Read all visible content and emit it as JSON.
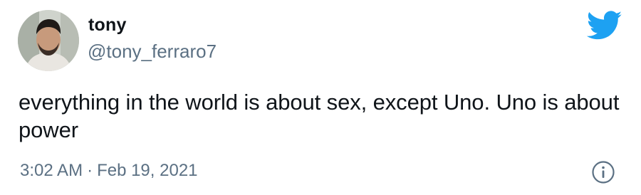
{
  "tweet": {
    "display_name": "tony",
    "handle": "@tony_ferraro7",
    "text": "everything in the world is about sex, except Uno. Uno is about power",
    "time": "3:02 AM",
    "separator": "·",
    "date": "Feb 19, 2021"
  },
  "icons": {
    "brand": "twitter-bird-icon",
    "info": "info-icon"
  },
  "colors": {
    "brand": "#1da1f2",
    "secondary_text": "#5b7083",
    "primary_text": "#0f1419"
  }
}
